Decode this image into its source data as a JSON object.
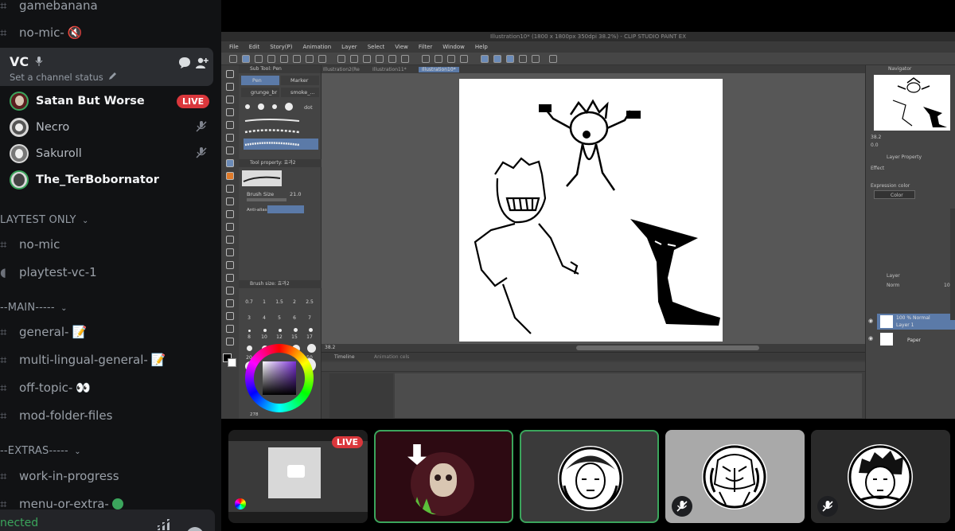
{
  "sidebar": {
    "channels_top": [
      {
        "name": "gamebanana",
        "emoji": ""
      },
      {
        "name": "no-mic-",
        "emoji": "🔇"
      }
    ],
    "voice_channel": {
      "name": "VC",
      "status_placeholder": "Set a channel status",
      "users": [
        {
          "name": "Satan But Worse",
          "live": true,
          "badge": "LIVE"
        },
        {
          "name": "Necro",
          "live": false,
          "muted": true
        },
        {
          "name": "Sakuroll",
          "live": false,
          "muted": true
        },
        {
          "name": "The_TerBobornator",
          "live": false,
          "muted": false
        }
      ]
    },
    "category_playtest": "LAYTEST ONLY",
    "playtest_channels": [
      {
        "name": "no-mic",
        "type": "text"
      },
      {
        "name": "playtest-vc-1",
        "type": "voice"
      }
    ],
    "category_main": "--MAIN-----",
    "main_channels": [
      {
        "name": "general-",
        "emoji": "📝"
      },
      {
        "name": "multi-lingual-general-",
        "emoji": "📝"
      },
      {
        "name": "off-topic-",
        "emoji": "👀"
      },
      {
        "name": "mod-folder-files",
        "emoji": ""
      }
    ],
    "category_extras": "--EXTRAS-----",
    "extras_channels": [
      {
        "name": "work-in-progress",
        "emoji": ""
      },
      {
        "name": "menu-or-extra-",
        "emoji": "🟢"
      }
    ],
    "connection_status": "nected"
  },
  "app": {
    "title": "Illustration10* (1800 x 1800px 350dpi 38.2%) - CLIP STUDIO PAINT EX",
    "menu": [
      "File",
      "Edit",
      "Story(P)",
      "Animation",
      "Layer",
      "Select",
      "View",
      "Filter",
      "Window",
      "Help"
    ],
    "doc_tabs": [
      "Illustration2(Re",
      "Illustration11*",
      "Illustration10*"
    ],
    "sub_tool_panel_title": "Sub Tool: Pen",
    "sub_tool_tabs": [
      "Pen",
      "Marker",
      "grunge_br",
      "smoke_...",
      "dot"
    ],
    "tool_property_title": "Tool property: 효과2",
    "brush_size_label": "Brush Size",
    "brush_size_value": "21.0",
    "antialias_label": "Anti-alias",
    "brush_size_panel_title": "Brush size: 효과2",
    "brush_sizes": [
      "0.7",
      "1",
      "1.5",
      "2",
      "2.5",
      "3",
      "4",
      "5",
      "6",
      "7",
      "8",
      "10",
      "12",
      "15",
      "17",
      "20",
      "25",
      "30",
      "40",
      "50"
    ],
    "zoom_value": "38.2",
    "color_value": "278",
    "timeline_tabs": [
      "Timeline",
      "Animation cels"
    ],
    "navigator_label": "Navigator",
    "navigator_zoom": "38.2",
    "navigator_rotation": "0.0",
    "layer_property_label": "Layer Property",
    "effect_label": "Effect",
    "expression_color_label": "Expression color",
    "expression_color_value": "Color",
    "layer_panel_label": "Layer",
    "blend_mode": "Norm",
    "opacity": "100",
    "layers": [
      {
        "line1": "100 % Normal",
        "line2": "Layer 1"
      },
      {
        "line1": "",
        "line2": "Paper"
      }
    ]
  },
  "tiles": [
    {
      "kind": "stream",
      "badge": "LIVE"
    },
    {
      "kind": "avatar",
      "speaking": true
    },
    {
      "kind": "avatar",
      "speaking": true
    },
    {
      "kind": "avatar",
      "muted": true
    },
    {
      "kind": "avatar",
      "muted": true
    }
  ],
  "colors": {
    "live_red": "#da373c",
    "speaking_green": "#3ba55c",
    "sidebar_bg": "#111214"
  }
}
